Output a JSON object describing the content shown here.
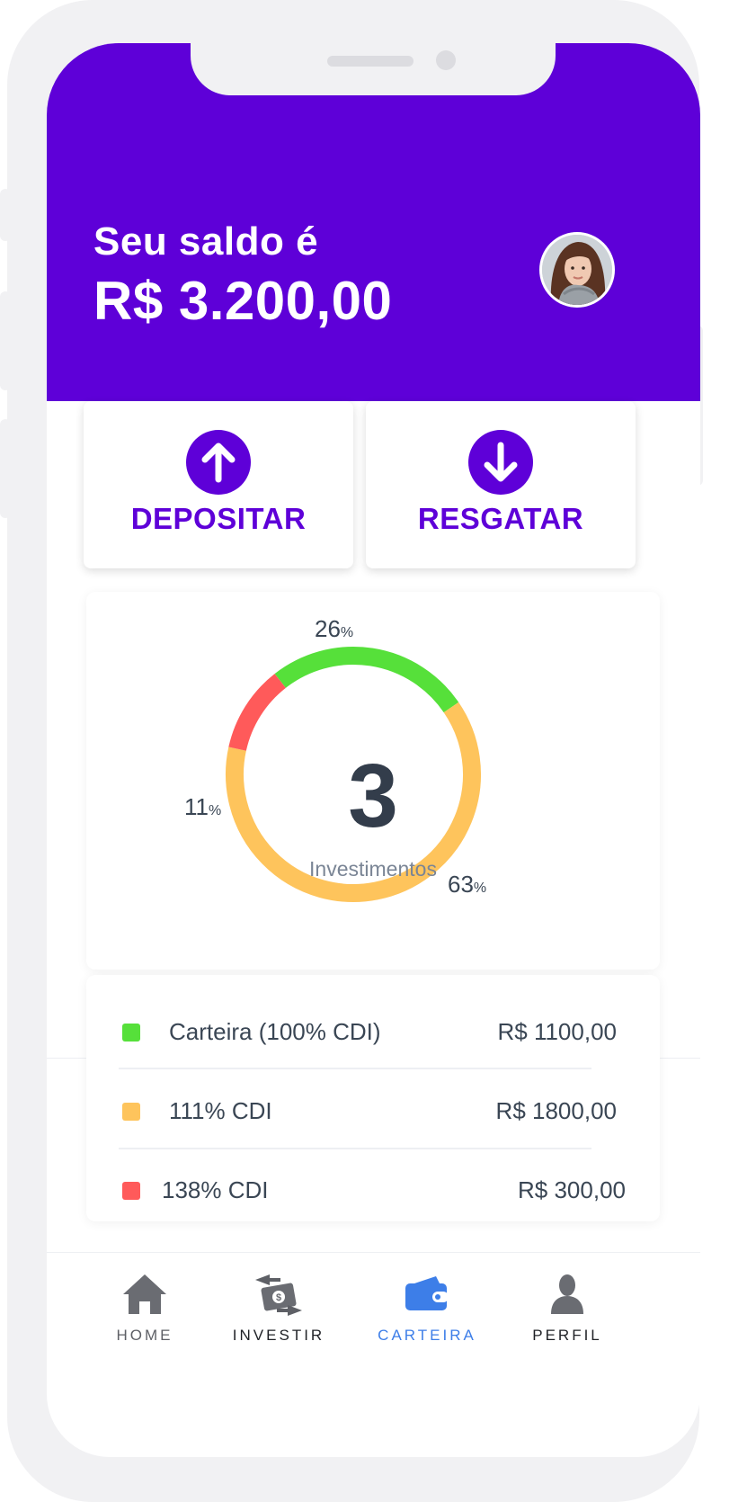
{
  "header": {
    "balance_label": "Seu saldo é",
    "balance_amount": "R$ 3.200,00",
    "background_color": "#5e00d8"
  },
  "actions": {
    "deposit_label": "DEPOSITAR",
    "deposit_icon": "arrow-up-icon",
    "withdraw_label": "RESGATAR",
    "withdraw_icon": "arrow-down-icon"
  },
  "portfolio": {
    "count": "3",
    "count_label": "Investimentos",
    "segments": [
      {
        "percent": "26",
        "color": "#56e03a",
        "value": 26
      },
      {
        "percent": "63",
        "color": "#fec45c",
        "value": 63
      },
      {
        "percent": "11",
        "color": "#ff5a5a",
        "value": 11
      }
    ],
    "percent_suffix": "%"
  },
  "investments": [
    {
      "name": "Carteira (100% CDI)",
      "amount": "R$ 1100,00",
      "color": "#56e03a"
    },
    {
      "name": "111% CDI",
      "amount": "R$ 1800,00",
      "color": "#fec45c"
    },
    {
      "name": "138% CDI",
      "amount": "R$ 300,00",
      "color": "#ff5a5a"
    }
  ],
  "nav": {
    "items": [
      {
        "label": "HOME",
        "icon": "home-icon",
        "active": false
      },
      {
        "label": "INVESTIR",
        "icon": "money-transfer-icon",
        "active": false
      },
      {
        "label": "CARTEIRA",
        "icon": "wallet-icon",
        "active": true
      },
      {
        "label": "PERFIL",
        "icon": "profile-icon",
        "active": false
      }
    ],
    "active_color": "#3d7ee8",
    "inactive_color": "#5e6066"
  }
}
